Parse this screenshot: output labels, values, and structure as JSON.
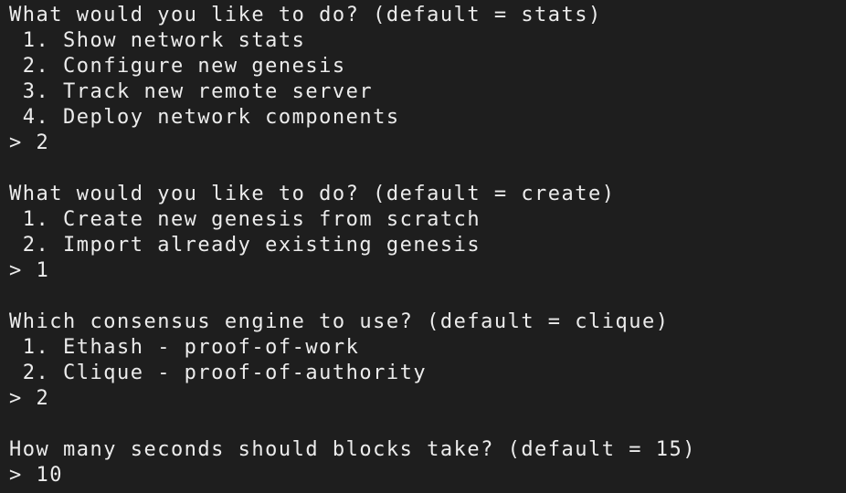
{
  "terminal": {
    "blocks": [
      {
        "question": "What would you like to do? (default = stats)",
        "options": [
          " 1. Show network stats",
          " 2. Configure new genesis",
          " 3. Track new remote server",
          " 4. Deploy network components"
        ],
        "answer": "> 2"
      },
      {
        "question": "What would you like to do? (default = create)",
        "options": [
          " 1. Create new genesis from scratch",
          " 2. Import already existing genesis"
        ],
        "answer": "> 1"
      },
      {
        "question": "Which consensus engine to use? (default = clique)",
        "options": [
          " 1. Ethash - proof-of-work",
          " 2. Clique - proof-of-authority"
        ],
        "answer": "> 2"
      },
      {
        "question": "How many seconds should blocks take? (default = 15)",
        "options": [],
        "answer": "> 10"
      }
    ]
  }
}
